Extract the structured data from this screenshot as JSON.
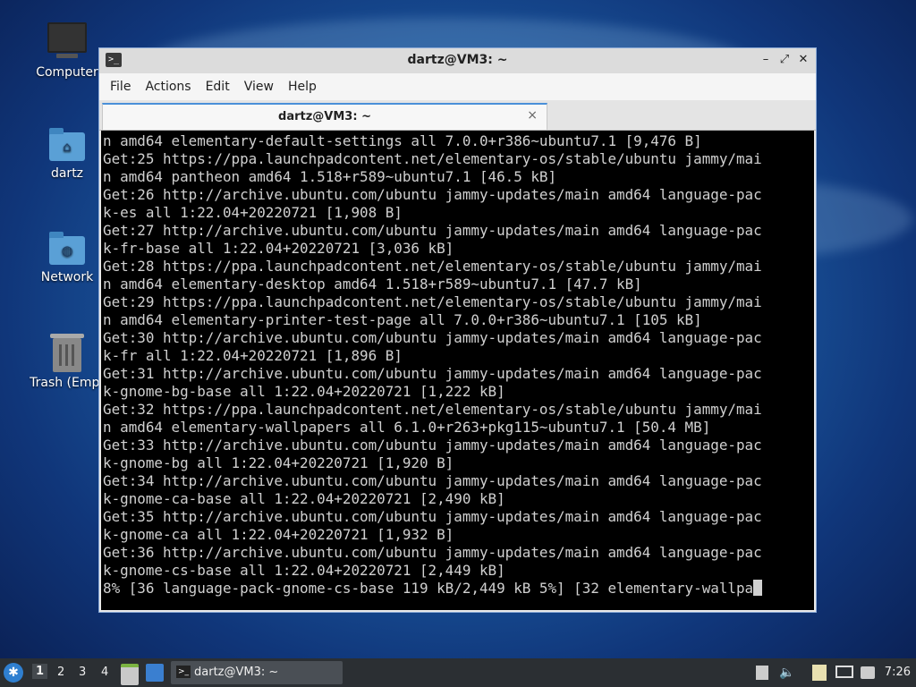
{
  "desktop": {
    "icons": [
      {
        "label": "Computer",
        "icon": "computer-icon"
      },
      {
        "label": "dartz",
        "icon": "home-folder-icon"
      },
      {
        "label": "Network",
        "icon": "network-folder-icon"
      },
      {
        "label": "Trash (Empt",
        "icon": "trash-icon"
      }
    ]
  },
  "window": {
    "title": "dartz@VM3: ~",
    "menu": [
      "File",
      "Actions",
      "Edit",
      "View",
      "Help"
    ],
    "tab": {
      "label": "dartz@VM3: ~",
      "close": "×"
    }
  },
  "terminal": {
    "lines": [
      "n amd64 elementary-default-settings all 7.0.0+r386~ubuntu7.1 [9,476 B]",
      "Get:25 https://ppa.launchpadcontent.net/elementary-os/stable/ubuntu jammy/mai",
      "n amd64 pantheon amd64 1.518+r589~ubuntu7.1 [46.5 kB]",
      "Get:26 http://archive.ubuntu.com/ubuntu jammy-updates/main amd64 language-pac",
      "k-es all 1:22.04+20220721 [1,908 B]",
      "Get:27 http://archive.ubuntu.com/ubuntu jammy-updates/main amd64 language-pac",
      "k-fr-base all 1:22.04+20220721 [3,036 kB]",
      "Get:28 https://ppa.launchpadcontent.net/elementary-os/stable/ubuntu jammy/mai",
      "n amd64 elementary-desktop amd64 1.518+r589~ubuntu7.1 [47.7 kB]",
      "Get:29 https://ppa.launchpadcontent.net/elementary-os/stable/ubuntu jammy/mai",
      "n amd64 elementary-printer-test-page all 7.0.0+r386~ubuntu7.1 [105 kB]",
      "Get:30 http://archive.ubuntu.com/ubuntu jammy-updates/main amd64 language-pac",
      "k-fr all 1:22.04+20220721 [1,896 B]",
      "Get:31 http://archive.ubuntu.com/ubuntu jammy-updates/main amd64 language-pac",
      "k-gnome-bg-base all 1:22.04+20220721 [1,222 kB]",
      "Get:32 https://ppa.launchpadcontent.net/elementary-os/stable/ubuntu jammy/mai",
      "n amd64 elementary-wallpapers all 6.1.0+r263+pkg115~ubuntu7.1 [50.4 MB]",
      "Get:33 http://archive.ubuntu.com/ubuntu jammy-updates/main amd64 language-pac",
      "k-gnome-bg all 1:22.04+20220721 [1,920 B]",
      "Get:34 http://archive.ubuntu.com/ubuntu jammy-updates/main amd64 language-pac",
      "k-gnome-ca-base all 1:22.04+20220721 [2,490 kB]",
      "Get:35 http://archive.ubuntu.com/ubuntu jammy-updates/main amd64 language-pac",
      "k-gnome-ca all 1:22.04+20220721 [1,932 B]",
      "Get:36 http://archive.ubuntu.com/ubuntu jammy-updates/main amd64 language-pac",
      "k-gnome-cs-base all 1:22.04+20220721 [2,449 kB]"
    ],
    "progress_line": "8% [36 language-pack-gnome-cs-base 119 kB/2,449 kB 5%] [32 elementary-wallpa"
  },
  "taskbar": {
    "start_icon": "lubuntu-menu-icon",
    "workspaces": [
      "1",
      "2",
      "3",
      "4"
    ],
    "task_label": "dartz@VM3: ~",
    "clock": "7:26"
  }
}
